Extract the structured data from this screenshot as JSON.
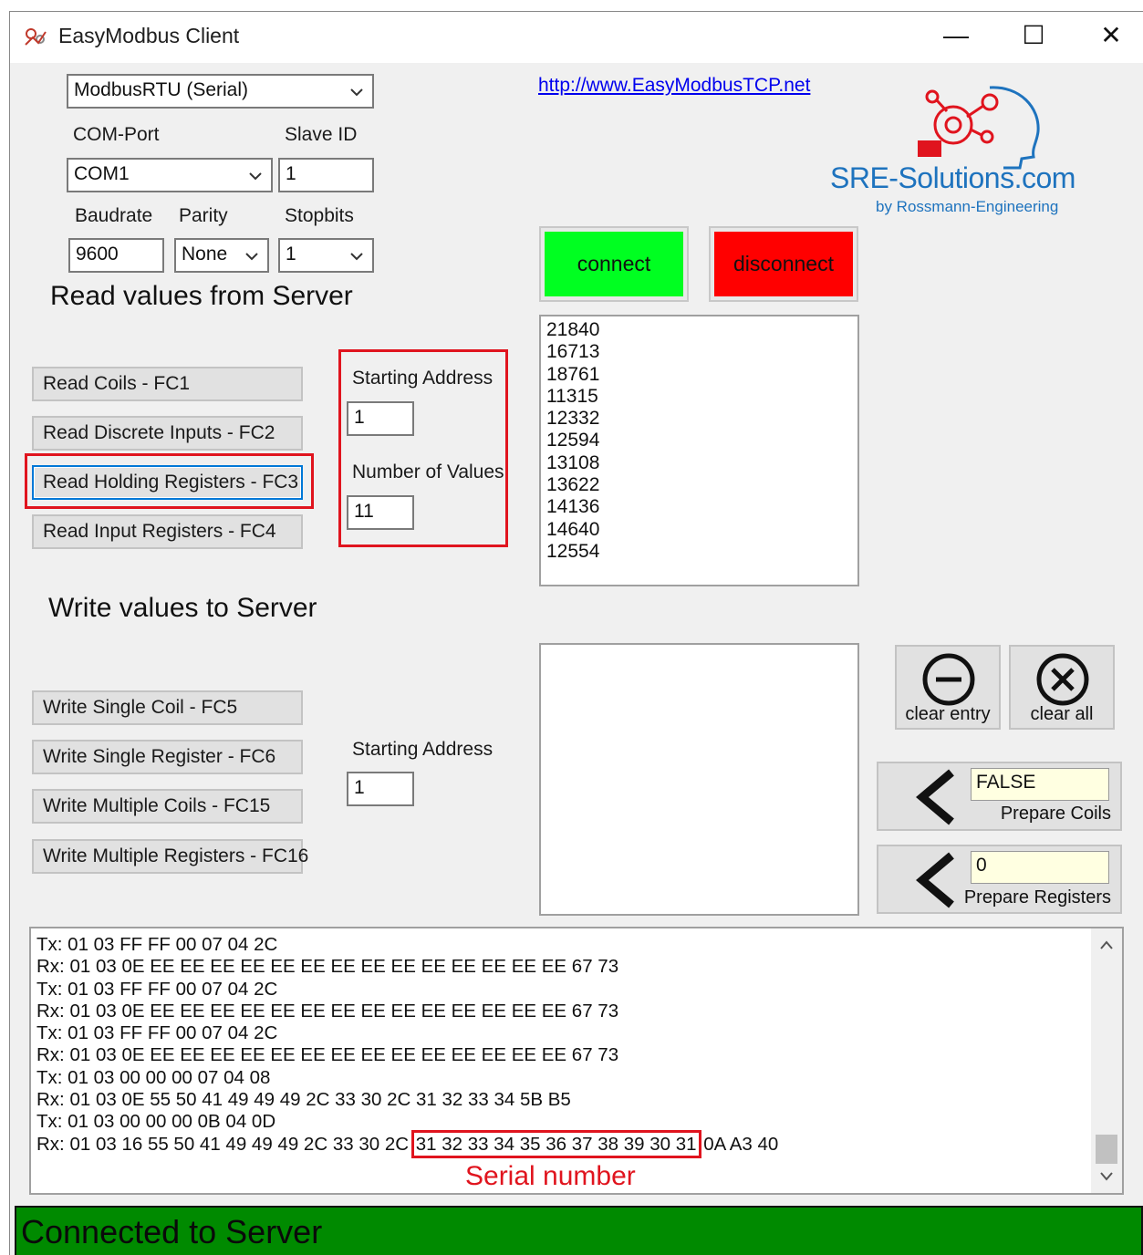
{
  "window": {
    "title": "EasyModbus Client",
    "controls": {
      "minimize": "—",
      "maximize": "☐",
      "close": "✕"
    }
  },
  "connection": {
    "mode": "ModbusRTU (Serial)",
    "com_port_label": "COM-Port",
    "com_port_value": "COM1",
    "slave_id_label": "Slave ID",
    "slave_id_value": "1",
    "baudrate_label": "Baudrate",
    "baudrate_value": "9600",
    "parity_label": "Parity",
    "parity_value": "None",
    "stopbits_label": "Stopbits",
    "stopbits_value": "1"
  },
  "link": "http://www.EasyModbusTCP.net",
  "logo": {
    "main": "SRE-Solutions.com",
    "sub": "by Rossmann-Engineering"
  },
  "buttons": {
    "connect": "connect",
    "disconnect": "disconnect"
  },
  "read": {
    "title": "Read values from Server",
    "buttons": [
      "Read Coils - FC1",
      "Read Discrete Inputs - FC2",
      "Read Holding Registers - FC3",
      "Read Input Registers - FC4"
    ],
    "starting_address_label": "Starting Address",
    "starting_address_value": "1",
    "number_of_values_label": "Number of Values",
    "number_of_values_value": "11"
  },
  "read_values": [
    "21840",
    "16713",
    "18761",
    "11315",
    "12332",
    "12594",
    "13108",
    "13622",
    "14136",
    "14640",
    "12554"
  ],
  "write": {
    "title": "Write values to Server",
    "buttons": [
      "Write Single Coil - FC5",
      "Write Single Register - FC6",
      "Write Multiple Coils - FC15",
      "Write Multiple Registers - FC16"
    ],
    "starting_address_label": "Starting Address",
    "starting_address_value": "1"
  },
  "tools": {
    "clear_entry": "clear entry",
    "clear_all": "clear all",
    "prepare_coils_value": "FALSE",
    "prepare_coils_label": "Prepare Coils",
    "prepare_registers_value": "0",
    "prepare_registers_label": "Prepare Registers"
  },
  "log": [
    "Tx: 01 03 FF FF 00 07 04 2C",
    "Rx: 01 03 0E EE EE EE EE EE EE EE EE EE EE EE EE EE EE 67 73",
    "Tx: 01 03 FF FF 00 07 04 2C",
    "Rx: 01 03 0E EE EE EE EE EE EE EE EE EE EE EE EE EE EE 67 73",
    "Tx: 01 03 FF FF 00 07 04 2C",
    "Rx: 01 03 0E EE EE EE EE EE EE EE EE EE EE EE EE EE EE 67 73",
    "Tx: 01 03 00 00 00 07 04 08",
    "Rx: 01 03 0E 55 50 41 49 49 49 2C 33 30 2C 31 32 33 34 5B B5",
    "Tx: 01 03 00 00 00 0B 04 0D"
  ],
  "log_last": {
    "prefix": "Rx: 01 03 16 55 50 41 49 49 49 2C 33 30 2C",
    "serial": "31 32 33 34 35 36 37 38 39 30 31",
    "suffix": "0A A3 40"
  },
  "annotation": "Serial number",
  "status": "Connected to Server",
  "colors": {
    "connect": "#00ff21",
    "disconnect": "#ff0000",
    "status": "#008a00",
    "highlight": "#e0141e",
    "input_yellow": "#ffffe1"
  }
}
